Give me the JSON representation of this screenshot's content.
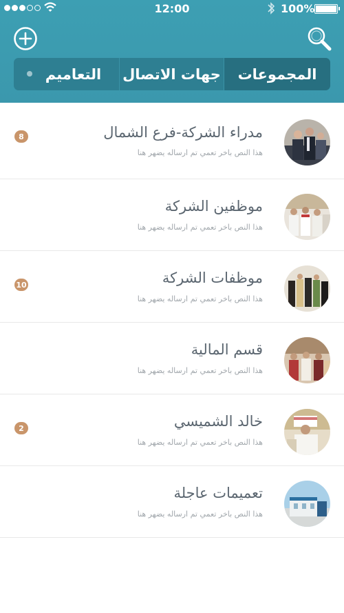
{
  "status_bar": {
    "time": "12:00",
    "battery": "100%"
  },
  "header": {
    "add_icon": "plus-circle-icon",
    "search_icon": "search-icon"
  },
  "tabs": [
    {
      "label": "التعاميم",
      "active": false
    },
    {
      "label": "جهات الاتصال",
      "active": false
    },
    {
      "label": "المجموعات",
      "active": true
    }
  ],
  "groups": [
    {
      "name": "مدراء الشركة-فرع الشمال",
      "preview": "هذا النص باخر تعمي تم ارساله يضهر هنا",
      "badge": "8"
    },
    {
      "name": "موظفين الشركة",
      "preview": "هذا النص باخر تعمي تم ارساله يضهر هنا",
      "badge": ""
    },
    {
      "name": "موظفات الشركة",
      "preview": "هذا النص باخر تعمي تم ارساله يضهر هنا",
      "badge": "10"
    },
    {
      "name": "قسم المالية",
      "preview": "هذا النص باخر تعمي تم ارساله يضهر هنا",
      "badge": ""
    },
    {
      "name": "خالد الشميسي",
      "preview": "هذا النص باخر تعمي تم ارساله يضهر هنا",
      "badge": "2"
    },
    {
      "name": "تعميمات عاجلة",
      "preview": "هذا النص باخر تعمي تم ارساله يضهر هنا",
      "badge": ""
    }
  ],
  "colors": {
    "header": "#3d9fb3",
    "segment_bg": "#2e7f92",
    "segment_active": "#276f80",
    "badge": "#c9956a"
  }
}
